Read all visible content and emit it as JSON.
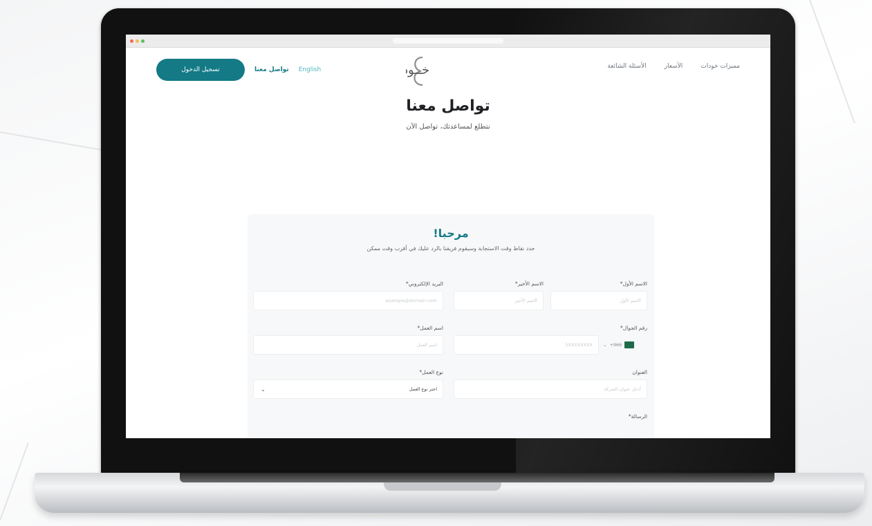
{
  "nav": {
    "links": [
      "مميزات خودات",
      "الأسعار",
      "الأسئلة الشائعة"
    ],
    "english_label": "English",
    "contact_label": "تواصل معنا",
    "login_label": "تسجيل الدخول"
  },
  "logo": {
    "text": "خــودات"
  },
  "hero": {
    "title": "تواصل معنا",
    "subtitle": "نتطلع لمساعدتك، تواصل الآن"
  },
  "card": {
    "title": "مرحبا!",
    "description": "حدد نقاط وقت الاستجابة وسيقوم فريقنا بالرد عليك في أقرب وقت ممكن"
  },
  "form": {
    "first_name": {
      "label": "الاسم الأول*",
      "placeholder": "الاسم الأول"
    },
    "last_name": {
      "label": "الاسم الأخير*",
      "placeholder": "الاسم الأخير"
    },
    "email": {
      "label": "البريد الإلكتروني*",
      "placeholder": "example@domain.com"
    },
    "phone": {
      "label": "رقم الجوال*",
      "country_code": "+966",
      "placeholder": "5XXXXXXXX"
    },
    "company": {
      "label": "اسم العمل*",
      "placeholder": "اسم العمل"
    },
    "address": {
      "label": "العنوان",
      "placeholder": "أدخل عنوان الشركة"
    },
    "business_type": {
      "label": "نوع العمل*",
      "value": "اختر نوع العمل"
    },
    "message": {
      "label": "الرسالة*"
    }
  },
  "colors": {
    "accent": "#137a86",
    "accent_light": "#4fb6c0",
    "flag": "#1e6b4a"
  }
}
